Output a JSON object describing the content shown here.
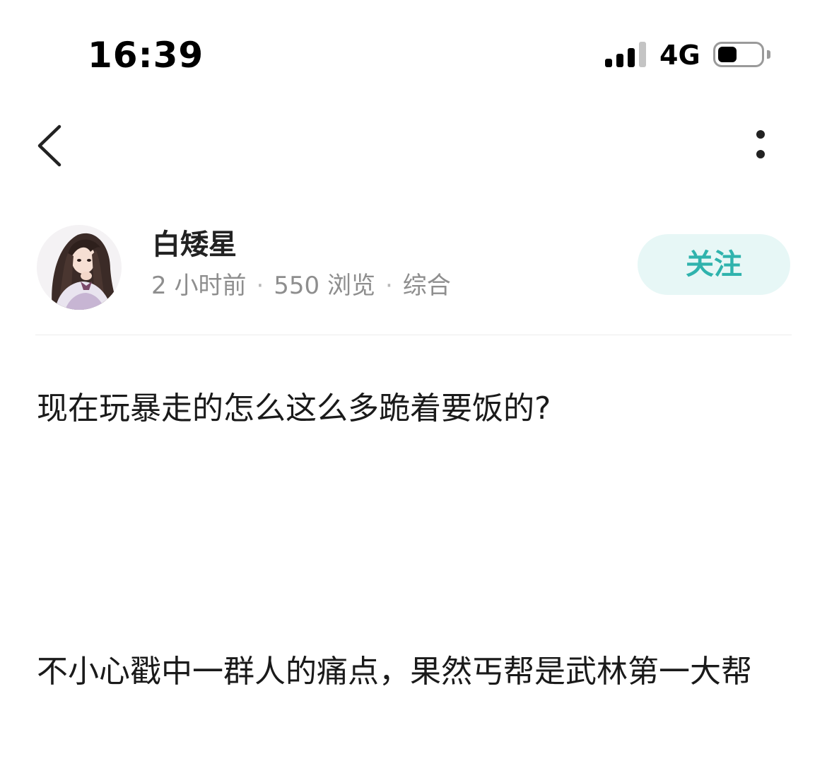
{
  "status_bar": {
    "time": "16:39",
    "network": "4G",
    "battery_level": 0.45,
    "signal_bars_active": 3
  },
  "nav": {
    "back_icon": "chevron-left-icon",
    "more_icon": "vertical-dots-icon"
  },
  "author": {
    "name": "白矮星",
    "meta": {
      "time": "2 小时前",
      "views": "550 浏览",
      "category": "综合",
      "separator": "·"
    },
    "follow_label": "关注"
  },
  "post": {
    "title": "现在玩暴走的怎么这么多跪着要饭的?",
    "body": "不小心戳中一群人的痛点，果然丐帮是武林第一大帮"
  },
  "colors": {
    "accent": "#2fb3ad",
    "follow_bg": "#e7f7f6",
    "meta_text": "#8e8e8e"
  }
}
